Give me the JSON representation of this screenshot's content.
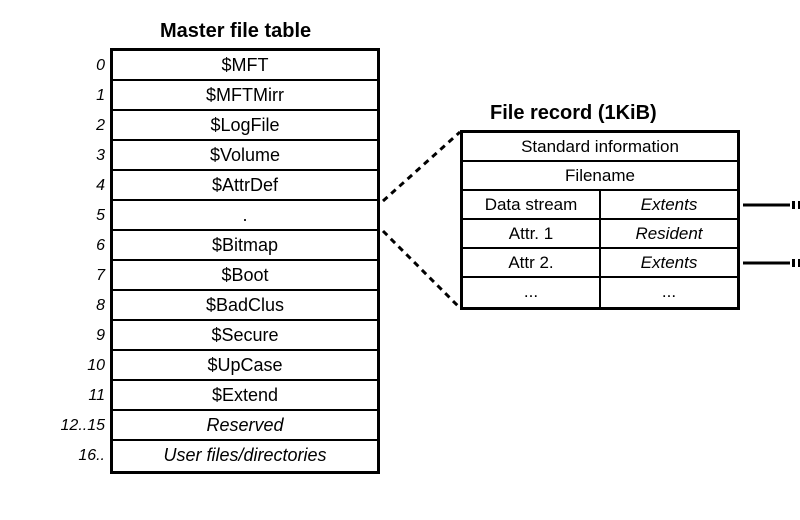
{
  "mft": {
    "title": "Master file table",
    "rows": [
      {
        "index": "0",
        "label": "$MFT",
        "italic": false
      },
      {
        "index": "1",
        "label": "$MFTMirr",
        "italic": false
      },
      {
        "index": "2",
        "label": "$LogFile",
        "italic": false
      },
      {
        "index": "3",
        "label": "$Volume",
        "italic": false
      },
      {
        "index": "4",
        "label": "$AttrDef",
        "italic": false
      },
      {
        "index": "5",
        "label": ".",
        "italic": false
      },
      {
        "index": "6",
        "label": "$Bitmap",
        "italic": false
      },
      {
        "index": "7",
        "label": "$Boot",
        "italic": false
      },
      {
        "index": "8",
        "label": "$BadClus",
        "italic": false
      },
      {
        "index": "9",
        "label": "$Secure",
        "italic": false
      },
      {
        "index": "10",
        "label": "$UpCase",
        "italic": false
      },
      {
        "index": "11",
        "label": "$Extend",
        "italic": false
      },
      {
        "index": "12..15",
        "label": "Reserved",
        "italic": true
      },
      {
        "index": "16..",
        "label": "User files/directories",
        "italic": true
      }
    ]
  },
  "file_record": {
    "title": "File record (1KiB)",
    "rows": [
      {
        "full": "Standard information"
      },
      {
        "full": "Filename"
      },
      {
        "left": "Data stream",
        "right": "Extents",
        "right_italic": true,
        "arrow": true
      },
      {
        "left": "Attr. 1",
        "right": "Resident",
        "right_italic": true,
        "arrow": false
      },
      {
        "left": "Attr 2.",
        "right": "Extents",
        "right_italic": true,
        "arrow": true
      },
      {
        "left": "...",
        "right": "...",
        "right_italic": false,
        "arrow": false
      }
    ]
  }
}
